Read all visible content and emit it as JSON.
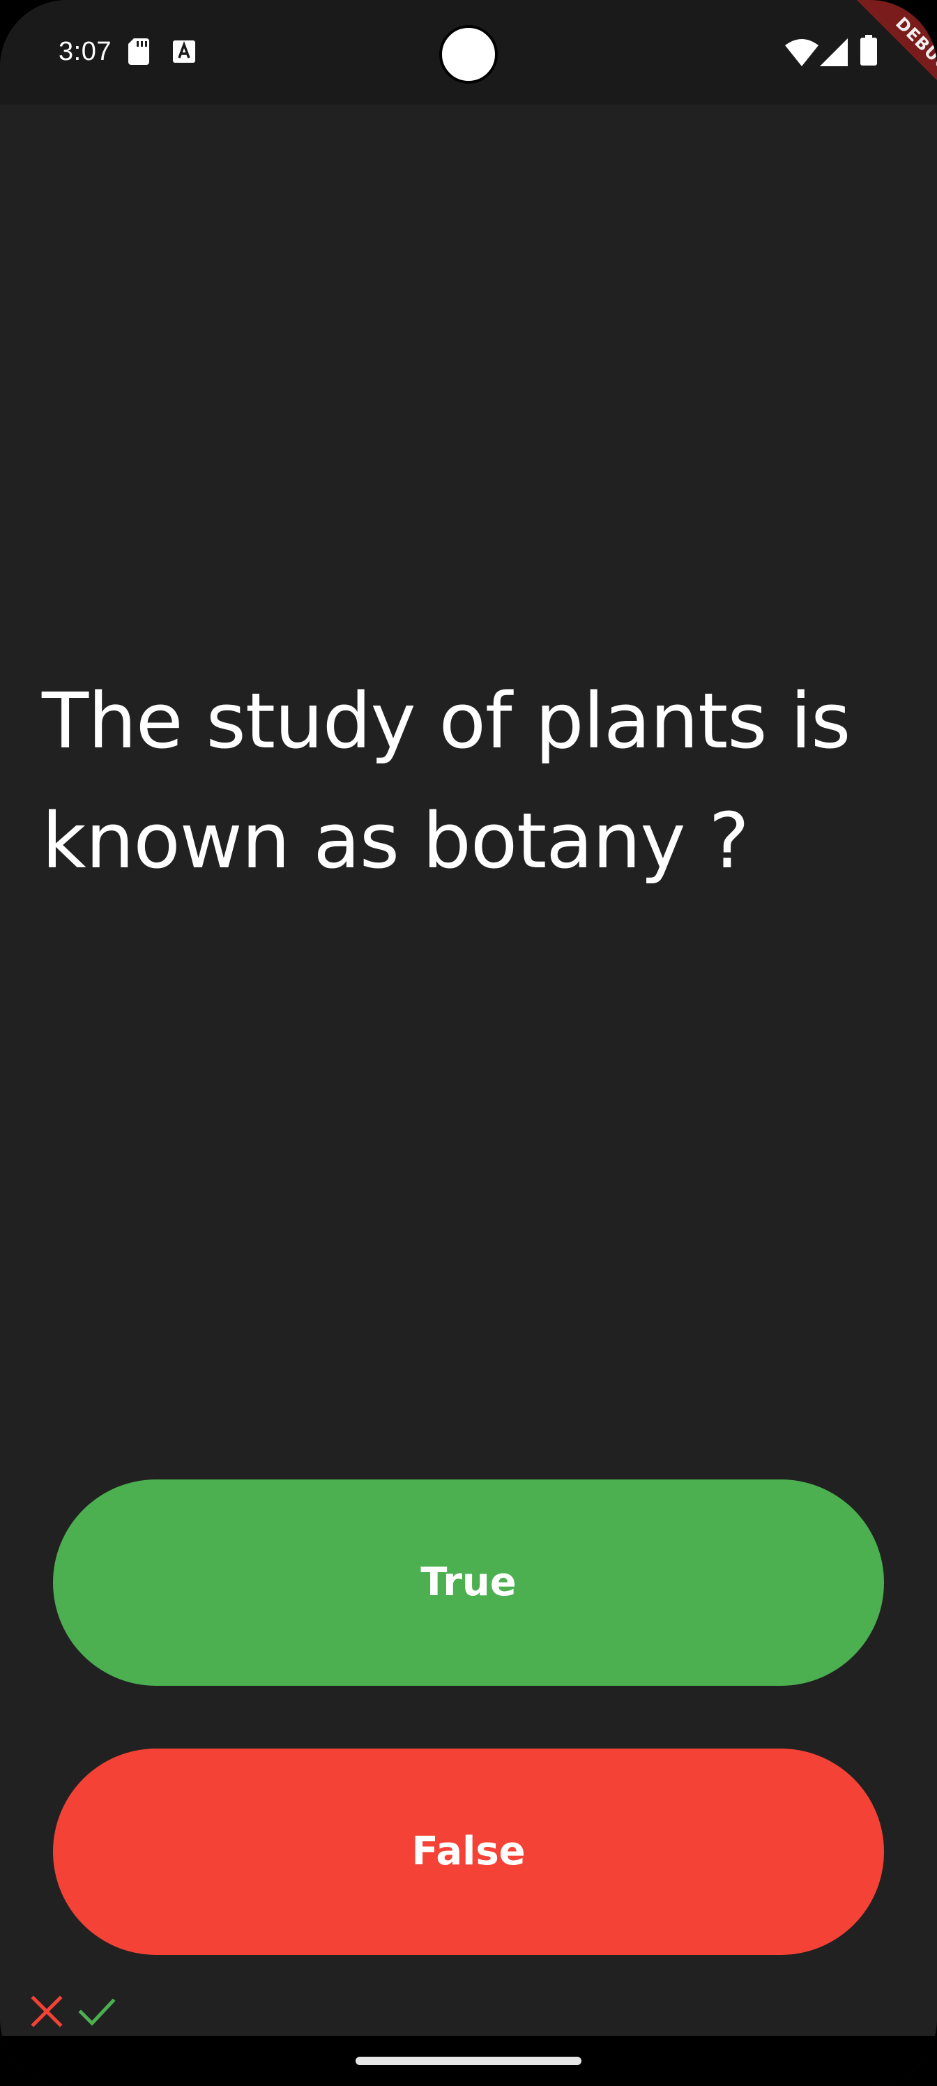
{
  "status_bar": {
    "time": "3:07",
    "icons": [
      "sd-card-icon",
      "a-notification-icon",
      "wifi-icon",
      "cell-signal-icon",
      "battery-icon"
    ]
  },
  "debug_banner": {
    "label": "DEBUG",
    "color": "#7a1c1c"
  },
  "quiz": {
    "question": "The study of plants is known as botany ?",
    "true_label": "True",
    "false_label": "False",
    "true_color": "#4caf50",
    "false_color": "#f44336",
    "background_color": "#212121"
  },
  "score_keeper": [
    {
      "result": "wrong",
      "icon": "close-icon",
      "color": "#f44336"
    },
    {
      "result": "correct",
      "icon": "check-icon",
      "color": "#4caf50"
    }
  ]
}
